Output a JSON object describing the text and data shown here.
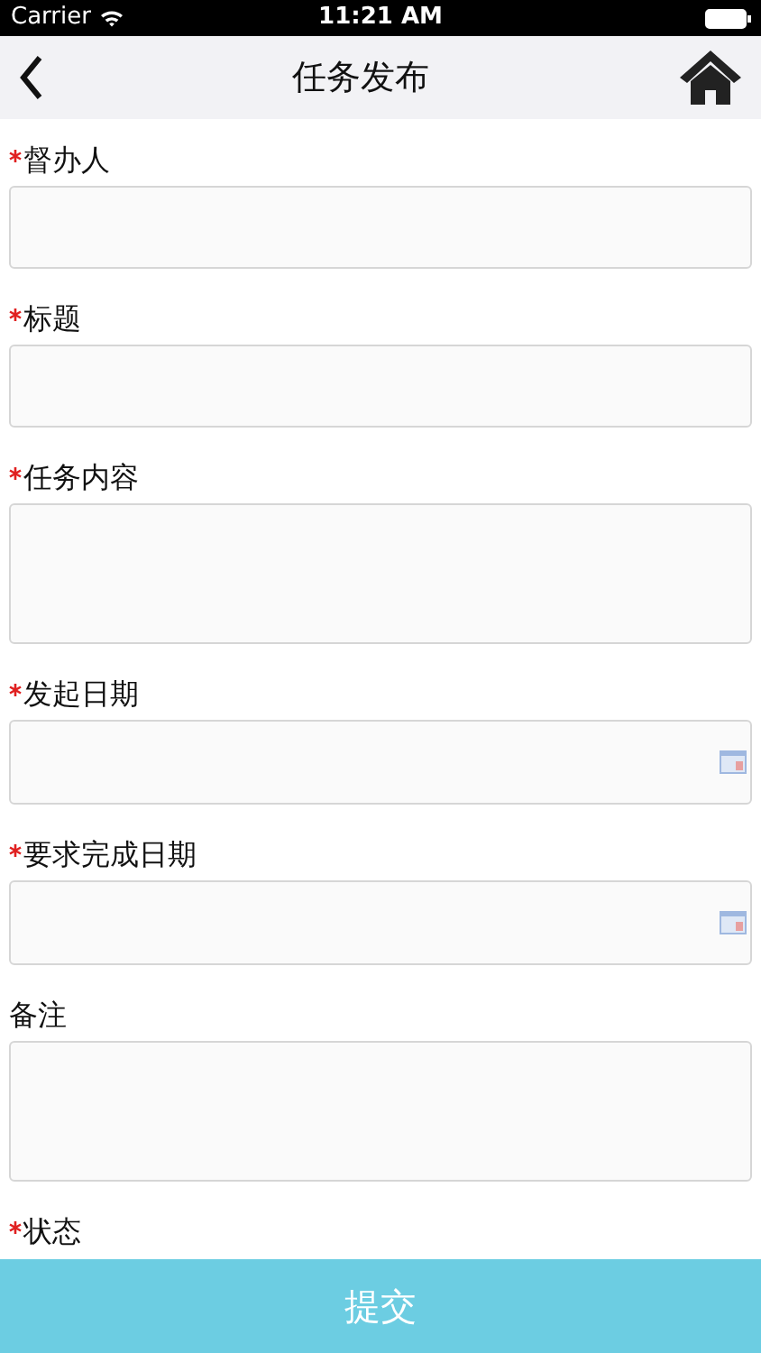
{
  "status_bar": {
    "carrier": "Carrier",
    "time": "11:21 AM"
  },
  "nav": {
    "title": "任务发布"
  },
  "fields": [
    {
      "label": "督办人",
      "required": true,
      "kind": "text"
    },
    {
      "label": "标题",
      "required": true,
      "kind": "text"
    },
    {
      "label": "任务内容",
      "required": true,
      "kind": "textarea"
    },
    {
      "label": "发起日期",
      "required": true,
      "kind": "date"
    },
    {
      "label": "要求完成日期",
      "required": true,
      "kind": "date"
    },
    {
      "label": "备注",
      "required": false,
      "kind": "textarea"
    },
    {
      "label": "状态",
      "required": true
    }
  ],
  "submit_button": "提交"
}
